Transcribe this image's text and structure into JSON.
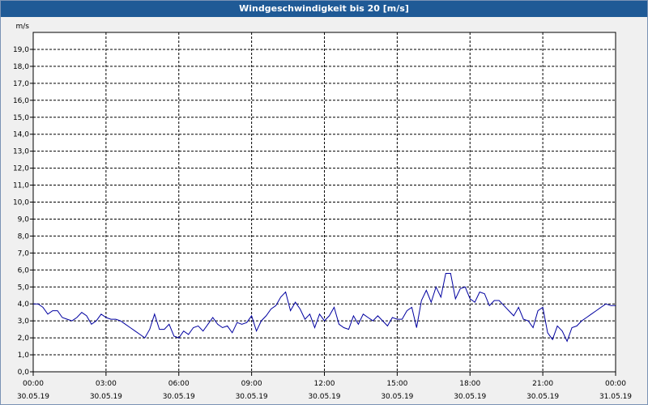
{
  "window": {
    "title": "Windgeschwindigkeit bis 20 [m/s]"
  },
  "chart_data": {
    "type": "line",
    "title": "Windgeschwindigkeit bis 20 [m/s]",
    "ylabel": "m/s",
    "xlabel": "",
    "ylim": [
      0,
      20
    ],
    "xlim_hours": [
      0,
      24
    ],
    "grid": true,
    "y_ticks": [
      "0,0",
      "1,0",
      "2,0",
      "3,0",
      "4,0",
      "5,0",
      "6,0",
      "7,0",
      "8,0",
      "9,0",
      "10,0",
      "11,0",
      "12,0",
      "13,0",
      "14,0",
      "15,0",
      "16,0",
      "17,0",
      "18,0",
      "19,0"
    ],
    "x_ticks": [
      {
        "time": "00:00",
        "date": "30.05.19"
      },
      {
        "time": "03:00",
        "date": "30.05.19"
      },
      {
        "time": "06:00",
        "date": "30.05.19"
      },
      {
        "time": "09:00",
        "date": "30.05.19"
      },
      {
        "time": "12:00",
        "date": "30.05.19"
      },
      {
        "time": "15:00",
        "date": "30.05.19"
      },
      {
        "time": "18:00",
        "date": "30.05.19"
      },
      {
        "time": "21:00",
        "date": "30.05.19"
      },
      {
        "time": "00:00",
        "date": "31.05.19"
      }
    ],
    "series": [
      {
        "color": "#0000a0",
        "x_hours": [
          0,
          0.2,
          0.4,
          0.6,
          0.8,
          1.0,
          1.2,
          1.4,
          1.6,
          1.8,
          2.0,
          2.2,
          2.4,
          2.6,
          2.8,
          3.0,
          3.2,
          3.4,
          3.6,
          3.8,
          4.0,
          4.2,
          4.4,
          4.6,
          4.8,
          5.0,
          5.2,
          5.4,
          5.6,
          5.8,
          6.0,
          6.2,
          6.4,
          6.6,
          6.8,
          7.0,
          7.2,
          7.4,
          7.6,
          7.8,
          8.0,
          8.2,
          8.4,
          8.6,
          8.8,
          9.0,
          9.2,
          9.4,
          9.6,
          9.8,
          10.0,
          10.2,
          10.4,
          10.6,
          10.8,
          11.0,
          11.2,
          11.4,
          11.6,
          11.8,
          12.0,
          12.2,
          12.4,
          12.6,
          12.8,
          13.0,
          13.2,
          13.4,
          13.6,
          13.8,
          14.0,
          14.2,
          14.4,
          14.6,
          14.8,
          15.0,
          15.2,
          15.4,
          15.6,
          15.8,
          16.0,
          16.2,
          16.4,
          16.6,
          16.8,
          17.0,
          17.2,
          17.4,
          17.6,
          17.8,
          18.0,
          18.2,
          18.4,
          18.6,
          18.8,
          19.0,
          19.2,
          19.4,
          19.6,
          19.8,
          20.0,
          20.2,
          20.4,
          20.6,
          20.8,
          21.0,
          21.2,
          21.4,
          21.6,
          21.8,
          22.0,
          22.2,
          22.4,
          22.6,
          22.8,
          23.0,
          23.2,
          23.4,
          23.6,
          23.8,
          24.0
        ],
        "values": [
          4.0,
          4.0,
          3.8,
          3.4,
          3.6,
          3.6,
          3.2,
          3.1,
          3.0,
          3.2,
          3.5,
          3.3,
          2.8,
          3.0,
          3.4,
          3.2,
          3.1,
          3.1,
          3.0,
          2.8,
          2.6,
          2.4,
          2.2,
          2.0,
          2.5,
          3.4,
          2.5,
          2.5,
          2.8,
          2.1,
          2.0,
          2.4,
          2.2,
          2.6,
          2.7,
          2.4,
          2.8,
          3.2,
          2.8,
          2.6,
          2.7,
          2.3,
          2.9,
          2.8,
          2.9,
          3.3,
          2.4,
          3.0,
          3.3,
          3.7,
          3.9,
          4.4,
          4.7,
          3.6,
          4.1,
          3.7,
          3.1,
          3.4,
          2.6,
          3.4,
          3.0,
          3.3,
          3.8,
          2.8,
          2.6,
          2.5,
          3.3,
          2.8,
          3.4,
          3.2,
          3.0,
          3.3,
          3.0,
          2.7,
          3.2,
          3.1,
          3.1,
          3.6,
          3.8,
          2.6,
          4.2,
          4.8,
          4.1,
          5.0,
          4.4,
          5.8,
          5.8,
          4.3,
          4.9,
          5.0,
          4.3,
          4.1,
          4.7,
          4.6,
          3.9,
          4.2,
          4.2,
          3.9,
          3.6,
          3.3,
          3.8,
          3.1,
          3.0,
          2.6,
          3.6,
          3.8,
          2.3,
          1.9,
          2.7,
          2.4,
          1.8,
          2.6,
          2.7,
          3.0,
          3.2,
          3.4,
          3.6,
          3.8,
          4.0,
          3.9,
          3.9
        ]
      }
    ]
  }
}
